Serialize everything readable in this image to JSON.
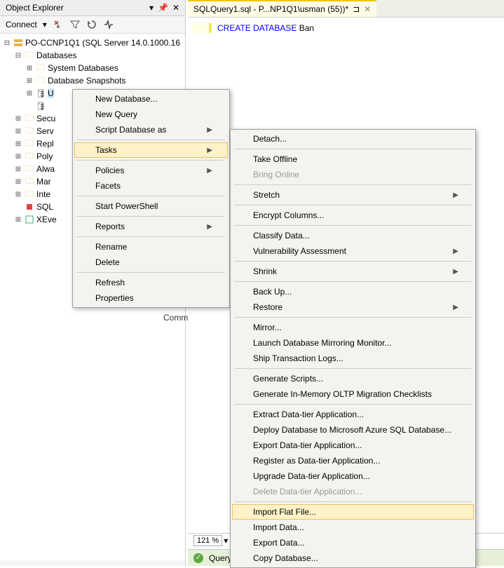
{
  "panel": {
    "title": "Object Explorer",
    "connect_label": "Connect"
  },
  "tree": {
    "server": "PO-CCNP1Q1 (SQL Server 14.0.1000.16",
    "databases": "Databases",
    "sys_db": "System Databases",
    "snapshots": "Database Snapshots",
    "db_u": "U",
    "nodes": [
      "Secu",
      "Serv",
      "Repl",
      "Poly",
      "Alwa",
      "Mar",
      "Inte",
      "SQL",
      "XEve"
    ]
  },
  "tab": {
    "title": "SQLQuery1.sql - P...NP1Q1\\usman (55))*"
  },
  "editor": {
    "kw1": "CREATE",
    "kw2": "DATABASE",
    "ident": "Ban"
  },
  "comments": "Comm",
  "zoom": "121 %",
  "status": "Query e",
  "menu1": {
    "new_db": "New Database...",
    "new_query": "New Query",
    "script": "Script Database as",
    "tasks": "Tasks",
    "policies": "Policies",
    "facets": "Facets",
    "powershell": "Start PowerShell",
    "reports": "Reports",
    "rename": "Rename",
    "delete": "Delete",
    "refresh": "Refresh",
    "properties": "Properties"
  },
  "menu2": {
    "detach": "Detach...",
    "take_offline": "Take Offline",
    "bring_online": "Bring Online",
    "stretch": "Stretch",
    "encrypt": "Encrypt Columns...",
    "classify": "Classify Data...",
    "vuln": "Vulnerability Assessment",
    "shrink": "Shrink",
    "backup": "Back Up...",
    "restore": "Restore",
    "mirror": "Mirror...",
    "launch_mirror": "Launch Database Mirroring Monitor...",
    "ship_logs": "Ship Transaction Logs...",
    "gen_scripts": "Generate Scripts...",
    "gen_oltp": "Generate In-Memory OLTP Migration Checklists",
    "extract_dac": "Extract Data-tier Application...",
    "deploy_azure": "Deploy Database to Microsoft Azure SQL Database...",
    "export_dac": "Export Data-tier Application...",
    "register_dac": "Register as Data-tier Application...",
    "upgrade_dac": "Upgrade Data-tier Application...",
    "delete_dac": "Delete Data-tier Application...",
    "import_flat": "Import Flat File...",
    "import_data": "Import Data...",
    "export_data": "Export Data...",
    "copy_db": "Copy Database..."
  }
}
